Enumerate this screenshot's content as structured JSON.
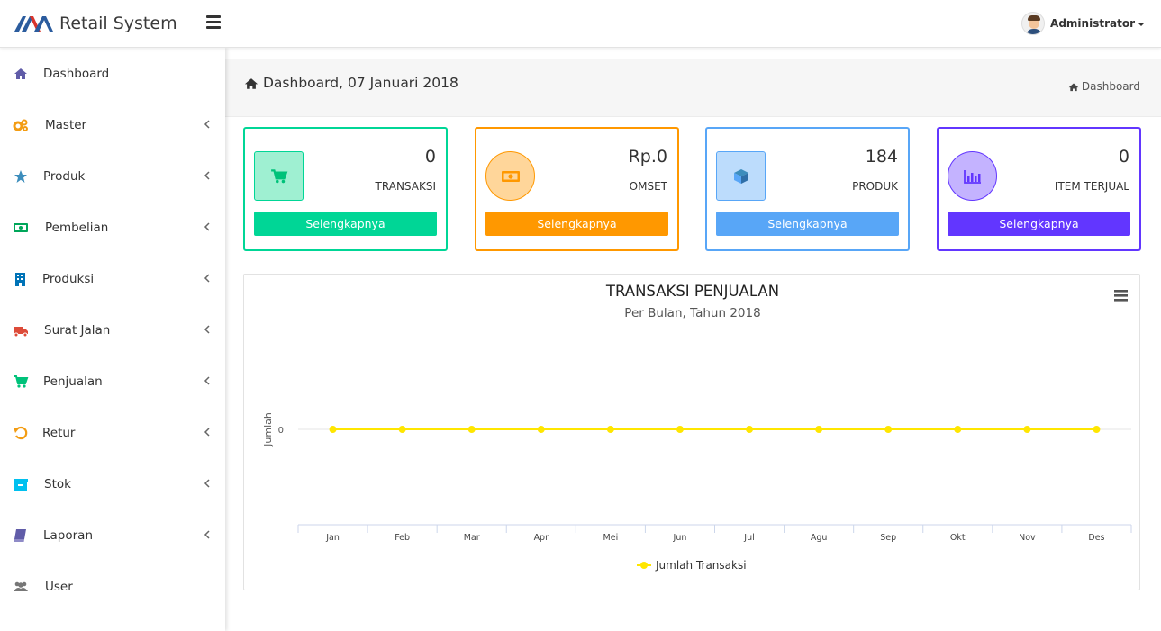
{
  "app": {
    "title": "Retail System"
  },
  "user": {
    "name": "Administrator"
  },
  "sidebar": {
    "items": [
      {
        "label": "Dashboard",
        "icon": "home-icon",
        "color": "#605ca8",
        "has_submenu": false
      },
      {
        "label": "Master",
        "icon": "gears-icon",
        "color": "#f39c12",
        "has_submenu": true
      },
      {
        "label": "Produk",
        "icon": "star-icon",
        "color": "#3c8dbc",
        "has_submenu": true
      },
      {
        "label": "Pembelian",
        "icon": "money-icon",
        "color": "#00a65a",
        "has_submenu": true
      },
      {
        "label": "Produksi",
        "icon": "building-icon",
        "color": "#0073b7",
        "has_submenu": true
      },
      {
        "label": "Surat Jalan",
        "icon": "truck-icon",
        "color": "#dd4b39",
        "has_submenu": true
      },
      {
        "label": "Penjualan",
        "icon": "cart-icon",
        "color": "#00c27a",
        "has_submenu": true
      },
      {
        "label": "Retur",
        "icon": "undo-icon",
        "color": "#f39c12",
        "has_submenu": true
      },
      {
        "label": "Stok",
        "icon": "archive-icon",
        "color": "#00c0ef",
        "has_submenu": true
      },
      {
        "label": "Laporan",
        "icon": "book-icon",
        "color": "#605ca8",
        "has_submenu": true
      },
      {
        "label": "User",
        "icon": "users-icon",
        "color": "#777777",
        "has_submenu": false
      }
    ]
  },
  "page": {
    "title": "Dashboard, 07 Januari 2018"
  },
  "breadcrumb": {
    "label": "Dashboard"
  },
  "cards": [
    {
      "value": "0",
      "label": "TRANSAKSI",
      "button": "Selengkapnya",
      "icon": "cart-icon",
      "color": "#00d696",
      "icon_bg": "#9ff0d2"
    },
    {
      "value": "Rp.0",
      "label": "OMSET",
      "button": "Selengkapnya",
      "icon": "money-icon",
      "color": "#ff9800",
      "icon_bg": "#ffd69a"
    },
    {
      "value": "184",
      "label": "PRODUK",
      "button": "Selengkapnya",
      "icon": "cube-icon",
      "color": "#58a6f7",
      "icon_bg": "#bcdcfc"
    },
    {
      "value": "0",
      "label": "ITEM TERJUAL",
      "button": "Selengkapnya",
      "icon": "bar-chart-icon",
      "color": "#6236ff",
      "icon_bg": "#c4b3ff"
    }
  ],
  "chart_data": {
    "type": "line",
    "title": "TRANSAKSI PENJUALAN",
    "subtitle": "Per Bulan, Tahun 2018",
    "ylabel": "Jumlah",
    "xlabel": "",
    "categories": [
      "Jan",
      "Feb",
      "Mar",
      "Apr",
      "Mei",
      "Jun",
      "Jul",
      "Agu",
      "Sep",
      "Okt",
      "Nov",
      "Des"
    ],
    "series": [
      {
        "name": "Jumlah Transaksi",
        "values": [
          0,
          0,
          0,
          0,
          0,
          0,
          0,
          0,
          0,
          0,
          0,
          0
        ],
        "color": "#ffe600"
      }
    ],
    "yticks": [
      "0"
    ],
    "legend": "bottom-center",
    "grid": true
  }
}
